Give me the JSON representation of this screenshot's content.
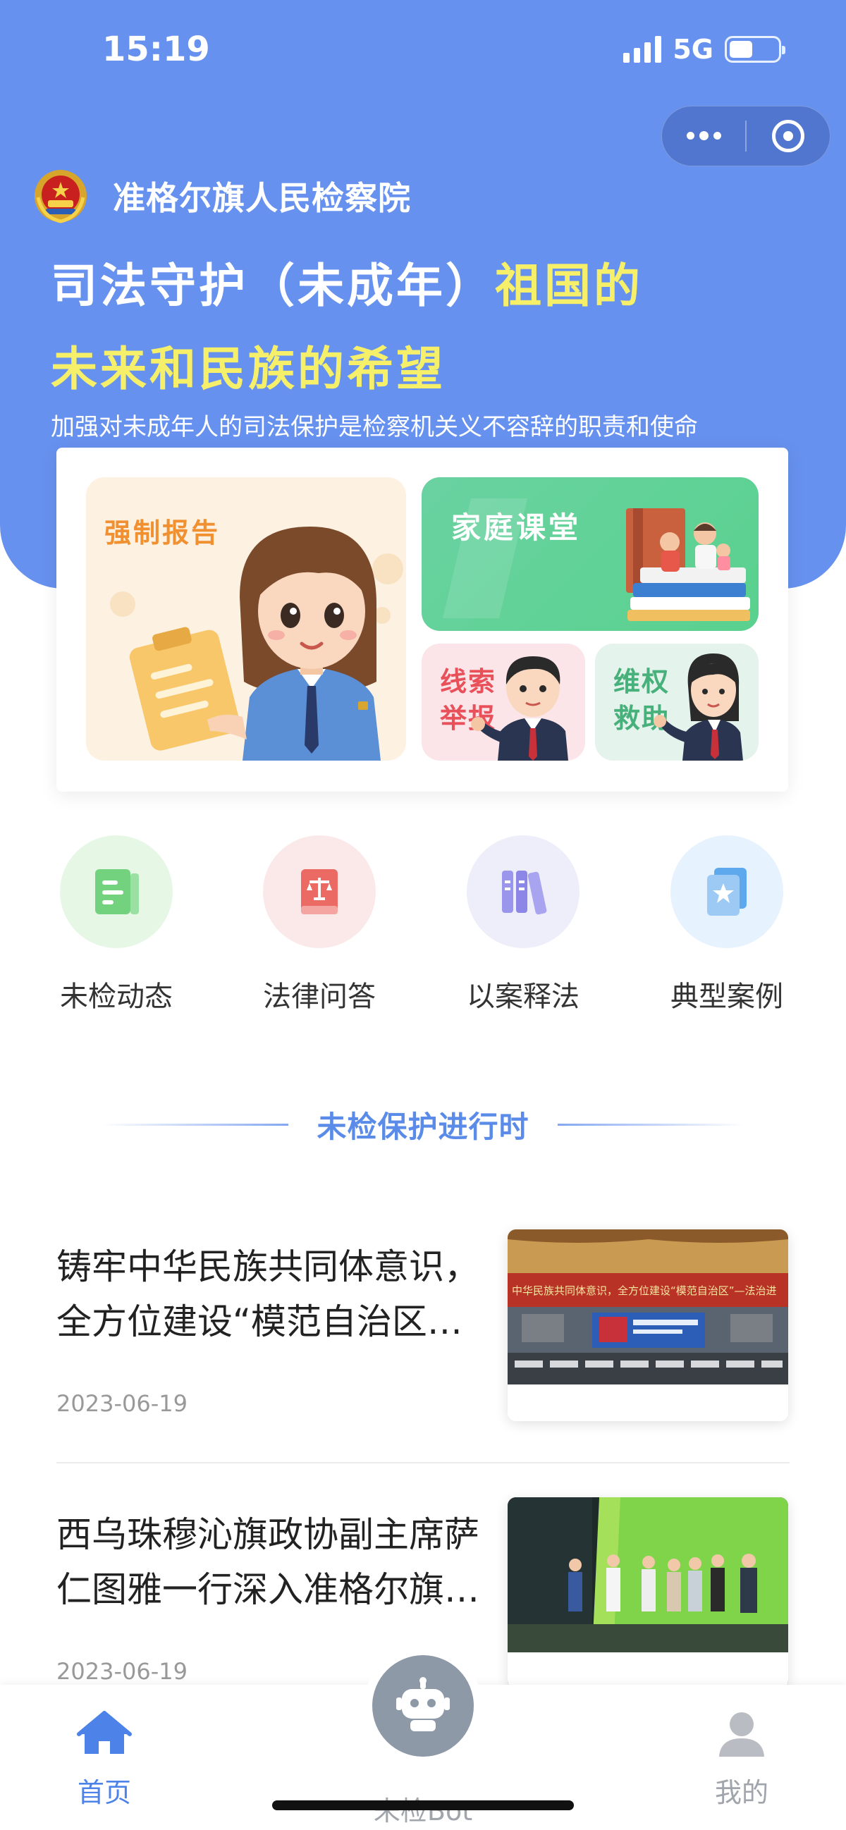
{
  "status_bar": {
    "time": "15:19",
    "network": "5G"
  },
  "header": {
    "org_name": "准格尔旗人民检察院",
    "slogan_line1_white": "司法守护（未成年）",
    "slogan_line1_yellow": "祖国的",
    "slogan_line2_yellow": "未来和民族的希望",
    "subline": "加强对未成年人的司法保护是检察机关义不容辞的职责和使命"
  },
  "feature_tiles": {
    "report": "强制报告",
    "family": "家庭课堂",
    "clue": "线索举报",
    "aid": "维权救助"
  },
  "quick_entries": [
    {
      "label": "未检动态",
      "icon": "document-icon",
      "bg": "#e6f7e6",
      "color": "#5cc66a"
    },
    {
      "label": "法律问答",
      "icon": "law-book-icon",
      "bg": "#fbe9e9",
      "color": "#e85a5a"
    },
    {
      "label": "以案释法",
      "icon": "books-icon",
      "bg": "#eeeefb",
      "color": "#8b86e6"
    },
    {
      "label": "典型案例",
      "icon": "star-book-icon",
      "bg": "#e6f2fd",
      "color": "#4d9de8"
    }
  ],
  "section_title": "未检保护进行时",
  "news": [
    {
      "title": "铸牢中华民族共同体意识，全方位建设“模范自治区…",
      "date": "2023-06-19",
      "thumb_banner": "中华民族共同体意识，全方位建设“模范自治区”—法治进"
    },
    {
      "title": "西乌珠穆沁旗政协副主席萨仁图雅一行深入准格尔旗…",
      "date": "2023-06-19"
    }
  ],
  "tabbar": {
    "home": "首页",
    "bot": "未检Bot",
    "mine": "我的"
  },
  "colors": {
    "primary": "#6691ee",
    "accent_yellow": "#f5ef6a",
    "tab_active": "#4d82e8"
  }
}
